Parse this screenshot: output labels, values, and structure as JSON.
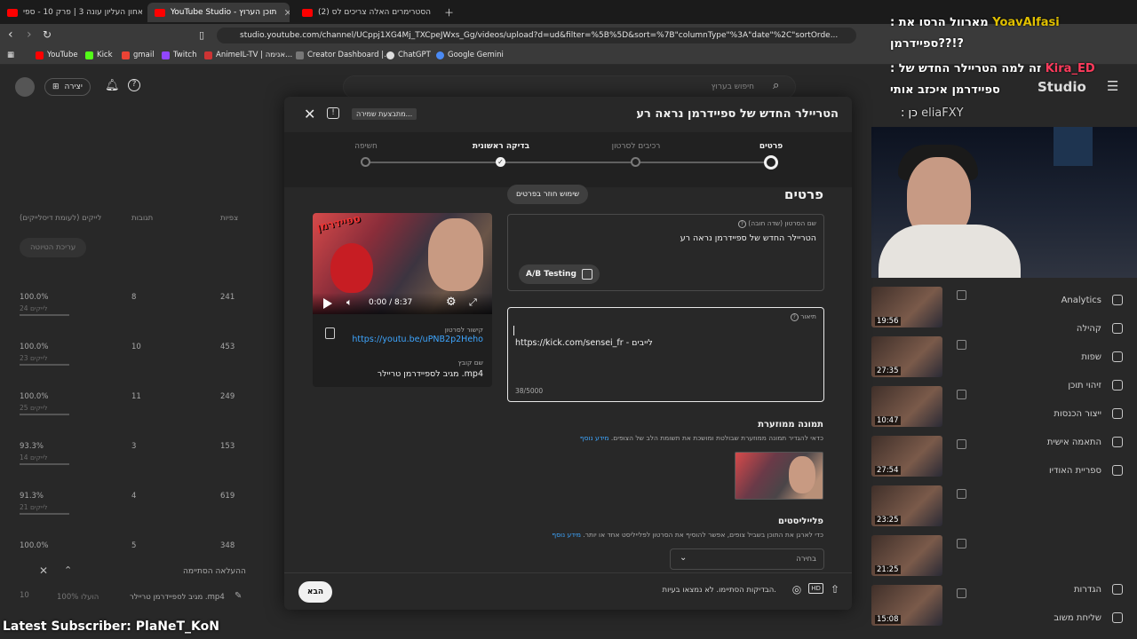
{
  "browser": {
    "tabs": [
      {
        "label": "האחון העליון עונה 3 | פרק 10 - ספי"
      },
      {
        "label": "YouTube Studio - תוכן הערוץ"
      },
      {
        "label": "(2) הסטרימרים האלה צריכים לס"
      }
    ],
    "url": "studio.youtube.com/channel/UCppj1XG4Mj_TXCpeJWxs_Gg/videos/upload?d=ud&filter=%5B%5D&sort=%7B\"columnType\"%3A\"date\"%2C\"sortOrde...",
    "bookmarks": [
      "YouTube",
      "Kick",
      "gmail",
      "Twitch",
      "AnimeIL-TV | אנימה...",
      "Creator Dashboard |...",
      "ChatGPT",
      "Google Gemini"
    ]
  },
  "studio": {
    "search_placeholder": "חיפוש בערוץ",
    "create_label": "יצירה",
    "logo": "Studio",
    "edit_label": "עריכת הטיוטה",
    "col_views": "צפיות",
    "col_comments": "תגובות",
    "col_likes": "לייקים (לעומת דיסלייקים)",
    "rows": [
      {
        "likes": "100.0%",
        "sub": "24 לייקים",
        "comments": "8",
        "views": "241"
      },
      {
        "likes": "100.0%",
        "sub": "23 לייקים",
        "comments": "10",
        "views": "453"
      },
      {
        "likes": "100.0%",
        "sub": "25 לייקים",
        "comments": "11",
        "views": "249"
      },
      {
        "likes": "93.3%",
        "sub": "14 לייקים",
        "comments": "3",
        "views": "153"
      },
      {
        "likes": "91.3%",
        "sub": "21 לייקים",
        "comments": "4",
        "views": "619"
      },
      {
        "likes": "100.0%",
        "sub": "",
        "comments": "5",
        "views": "348"
      }
    ],
    "nav": [
      "Analytics",
      "קהילה",
      "שפות",
      "זיהוי תוכן",
      "ייצור הכנסות",
      "התאמה אישית",
      "ספריית האודיו",
      "הגדרות",
      "שליחת משוב"
    ],
    "thumb_durations": [
      "19:56",
      "27:35",
      "10:47",
      "27:54",
      "23:25",
      "21:25",
      "15:08"
    ],
    "upload_done_label": "ההעלאה הסתיימה",
    "upload_file": "מגיב לספיידרמן טריילר .mp4",
    "upload_status": "100% הועלו"
  },
  "stream": {
    "chat": [
      {
        "user": "YoavAlfasi",
        "text": ": מארוול הרסו את",
        "line2": "ספיידרמן??!?"
      },
      {
        "user": "Kira_ED",
        "text": ": זה למה הטריילר החדש של",
        "line2": "ספיידרמן איכזב אותי"
      },
      {
        "user": "eliaFXY",
        "text": ": כן"
      }
    ],
    "latest_subscriber": "Latest Subscriber: PlaNeT_KoN"
  },
  "modal": {
    "title": "הטריילר החדש של ספיידרמן נראה רע",
    "saving_badge": "מתבצעת שמירה...",
    "steps": [
      "פרטים",
      "רכיבים לסרטון",
      "בדיקה ראשונית",
      "חשיפה"
    ],
    "section_title": "פרטים",
    "reuse_details": "שימוש חוזר בפרטים",
    "title_field": {
      "label": "שם הסרטון (שדה חובה)",
      "value": "הטריילר החדש של ספיידרמן נראה רע"
    },
    "ab_testing": "A/B Testing",
    "description_field": {
      "label": "תיאור",
      "value": "לייבים - https://kick.com/sensei_fr",
      "counter": "38/5000"
    },
    "video_link_label": "קישור לסרטון",
    "video_link": "https://youtu.be/uPNB2p2Heho",
    "filename_label": "שם קובץ",
    "filename": "מגיב לספיידרמן טריילר .mp4",
    "player_time": "0:00 / 8:37",
    "thumb_overlay_text": "ספיידרמן",
    "thumbnail_heading": "תמונה ממוזערת",
    "thumbnail_desc": "כדאי להגדיר תמונה ממוזערת שבולטת ומושכת את תשומת הלב של הצופים.",
    "learn_more": "מידע נוסף",
    "playlists_heading": "פלייליסטים",
    "playlists_desc": "כדי לארגן את התוכן בשביל צופים, אפשר להוסיף את הסרטון לפלייליסט אחד או יותר.",
    "playlist_select": "בחירה",
    "checks_status": "הבדיקות הסתיימו. לא נמצאו בעיות.",
    "next_button": "הבא"
  }
}
